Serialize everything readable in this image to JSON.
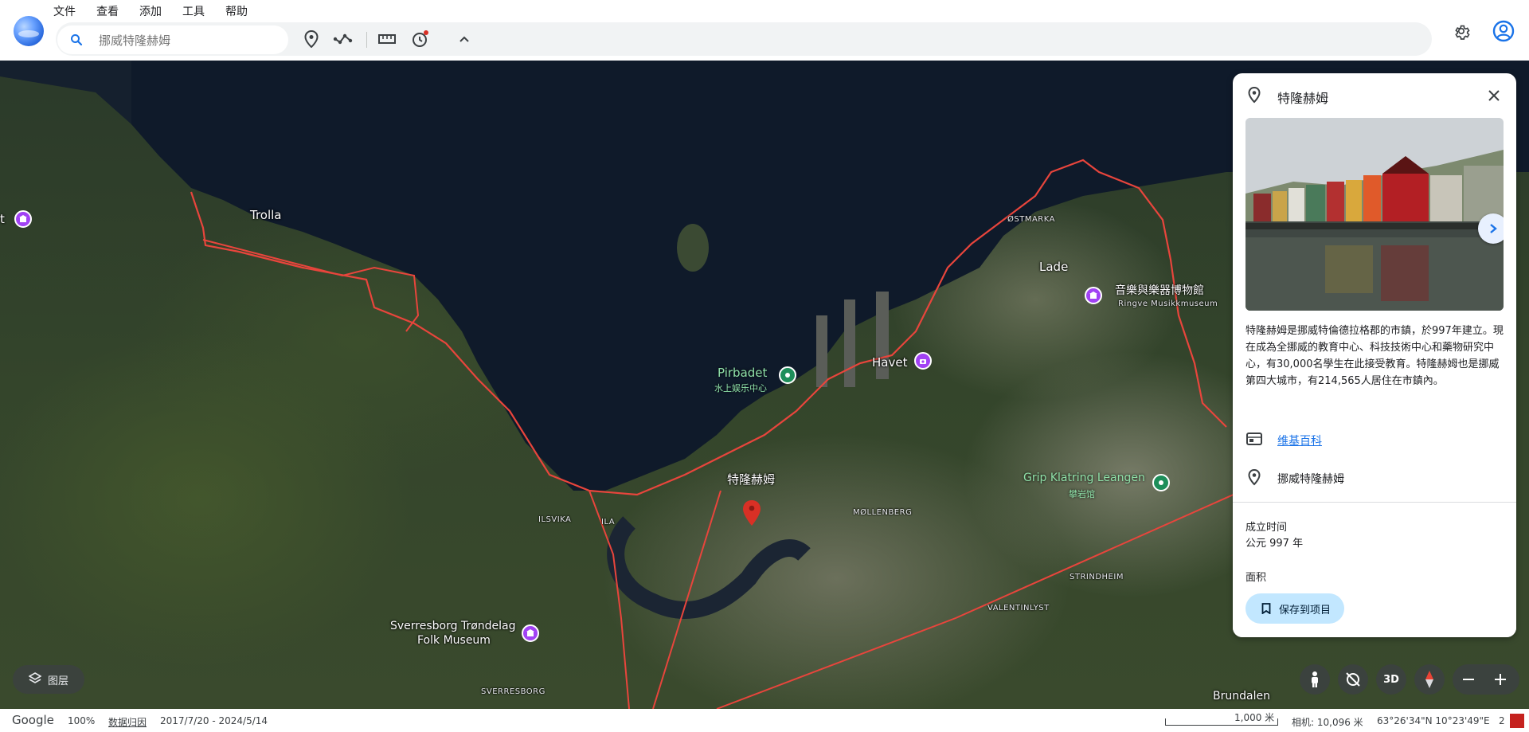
{
  "menu": {
    "items": [
      "文件",
      "查看",
      "添加",
      "工具",
      "帮助"
    ]
  },
  "toolbar": {
    "search_placeholder": "挪威特隆赫姆",
    "tools": [
      "placemark-icon",
      "path-icon",
      "ruler-icon",
      "history-icon",
      "collapse-icon"
    ]
  },
  "map": {
    "labels": {
      "trolla": "Trolla",
      "ostmarka": "ØSTMARKA",
      "lade": "Lade",
      "music_museum_zh": "音樂與樂器博物館",
      "music_museum_en": "Ringve Musikkmuseum",
      "pirbadet": "Pirbadet",
      "pirbadet_sub": "水上娱乐中心",
      "havet": "Havet",
      "trondheim": "特隆赫姆",
      "grip": "Grip Klatring Leangen",
      "grip_sub": "攀岩馆",
      "ilsvika": "ILSVIKA",
      "ila": "ILA",
      "mollenberg": "MØLLENBERG",
      "strindheim": "STRINDHEIM",
      "valentinlyst": "VALENTINLYST",
      "sverresborg_museum_1": "Sverresborg Trøndelag",
      "sverresborg_museum_2": "Folk Museum",
      "sverresborg": "SVERRESBORG",
      "brundalen": "Brundalen",
      "left_edge": "t"
    }
  },
  "panel": {
    "title": "特隆赫姆",
    "description": "特隆赫姆是挪威特倫德拉格郡的市鎮，於997年建立。現在成為全挪威的教育中心、科技技術中心和藥物研究中心，有30,000名學生在此接受教育。特隆赫姆也是挪威第四大城市，有214,565人居住在市鎮內。",
    "wiki_label": "维基百科",
    "location_label": "挪威特隆赫姆",
    "founded_label": "成立时间",
    "founded_value": "公元 997 年",
    "area_label": "面积",
    "save_label": "保存到项目"
  },
  "controls": {
    "layers_label": "图层",
    "three_d_label": "3D"
  },
  "status": {
    "google": "Google",
    "zoom": "100%",
    "attribution": "数据归因",
    "dates": "2017/7/20 - 2024/5/14",
    "scale": "1,000 米",
    "camera": "相机: 10,096 米",
    "coords": "63°26'34\"N 10°23'49\"E",
    "extra": "2"
  },
  "colors": {
    "accent": "#1a73e8",
    "save_bg": "#c2e7ff",
    "boundary": "#e8453c",
    "poi_green": "#1e8e5a",
    "poi_purple": "#a142f4",
    "marker_red": "#d93025"
  }
}
